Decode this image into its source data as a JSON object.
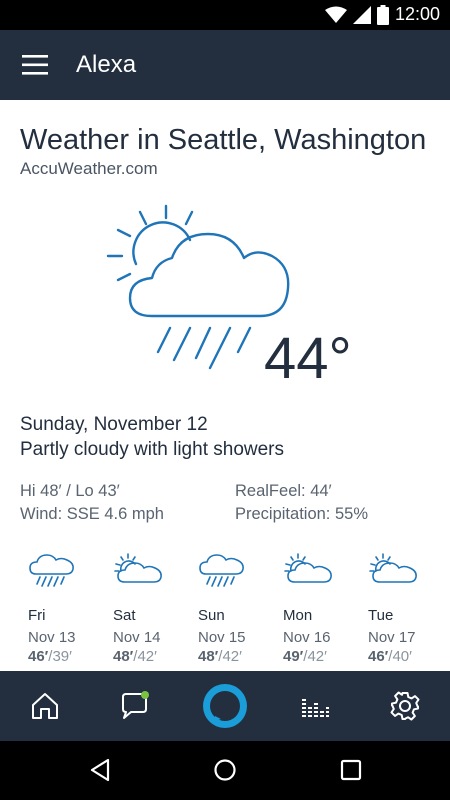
{
  "status_bar": {
    "time": "12:00"
  },
  "header": {
    "title": "Alexa"
  },
  "weather": {
    "title": "Weather in Seattle, Washington",
    "source": "AccuWeather.com",
    "temperature": "44°",
    "date": "Sunday, November 12",
    "summary": "Partly cloudy with light showers",
    "hi_lo": "Hi 48′ / Lo 43′",
    "wind": "Wind: SSE 4.6 mph",
    "realfeel": "RealFeel: 44′",
    "precipitation": "Precipitation: 55%",
    "icon": "partly-cloudy-showers-icon"
  },
  "forecast": [
    {
      "day": "Fri",
      "date": "Nov 13",
      "hi": "46′",
      "lo": "/39′",
      "icon": "rain-cloud-icon"
    },
    {
      "day": "Sat",
      "date": "Nov 14",
      "hi": "48′",
      "lo": "/42′",
      "icon": "partly-cloudy-icon"
    },
    {
      "day": "Sun",
      "date": "Nov 15",
      "hi": "48′",
      "lo": "/42′",
      "icon": "rain-cloud-icon"
    },
    {
      "day": "Mon",
      "date": "Nov 16",
      "hi": "49′",
      "lo": "/42′",
      "icon": "partly-cloudy-icon"
    },
    {
      "day": "Tue",
      "date": "Nov 17",
      "hi": "46′",
      "lo": "/40′",
      "icon": "partly-cloudy-icon"
    }
  ],
  "bottom_nav": [
    "home-icon",
    "conversation-icon",
    "alexa-ring-icon",
    "music-equalizer-icon",
    "settings-gear-icon"
  ],
  "colors": {
    "header": "#232f3e",
    "accent": "#1a9dd8",
    "icon_blue": "#1f75b8",
    "badge_green": "#7cc242"
  }
}
